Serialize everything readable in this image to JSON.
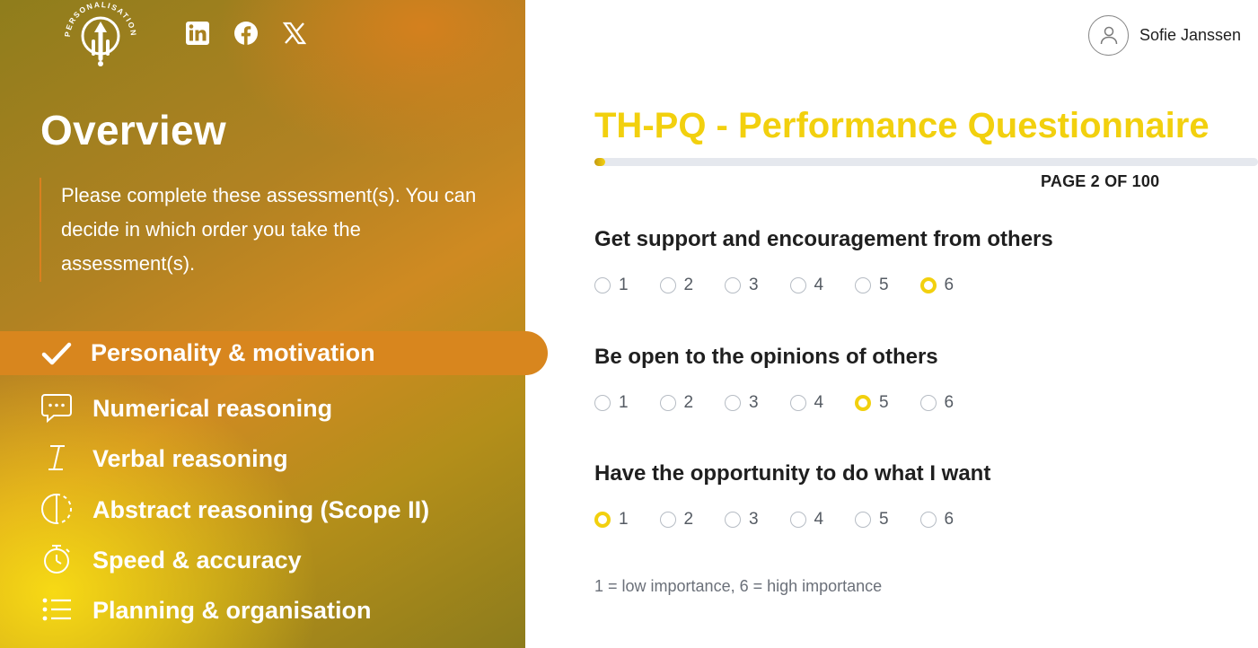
{
  "brand": {
    "logo_text": "PERSONALISATION"
  },
  "colors": {
    "accent_yellow": "#f2d00e",
    "accent_orange": "#d8861e",
    "title_yellow": "#f2d00e"
  },
  "social": [
    {
      "name": "linkedin-icon"
    },
    {
      "name": "facebook-icon"
    },
    {
      "name": "x-icon"
    }
  ],
  "sidebar": {
    "title": "Overview",
    "intro": "Please complete these assessment(s). You can decide in which order you take the assessment(s).",
    "items": [
      {
        "label": "Personality & motivation",
        "icon": "checkmark-icon",
        "active": true,
        "completed": true
      },
      {
        "label": "Numerical reasoning",
        "icon": "chat-bubble-icon"
      },
      {
        "label": "Verbal reasoning",
        "icon": "text-cursor-icon"
      },
      {
        "label": "Abstract reasoning (Scope II)",
        "icon": "half-circle-icon"
      },
      {
        "label": "Speed & accuracy",
        "icon": "stopwatch-icon"
      },
      {
        "label": "Planning & organisation",
        "icon": "list-icon"
      }
    ]
  },
  "user": {
    "name": "Sofie Janssen"
  },
  "questionnaire": {
    "title": "TH-PQ - Performance Questionnaire",
    "page_indicator": "PAGE 2 OF 100",
    "progress_fraction": 0.02,
    "questions": [
      {
        "label": "Get support and encouragement from others",
        "options": [
          "1",
          "2",
          "3",
          "4",
          "5",
          "6"
        ],
        "selected": "6"
      },
      {
        "label": "Be open to the opinions of others",
        "options": [
          "1",
          "2",
          "3",
          "4",
          "5",
          "6"
        ],
        "selected": "5"
      },
      {
        "label": "Have the opportunity to do what I want",
        "options": [
          "1",
          "2",
          "3",
          "4",
          "5",
          "6"
        ],
        "selected": "1"
      }
    ],
    "legend": "1 = low importance, 6 = high importance"
  }
}
